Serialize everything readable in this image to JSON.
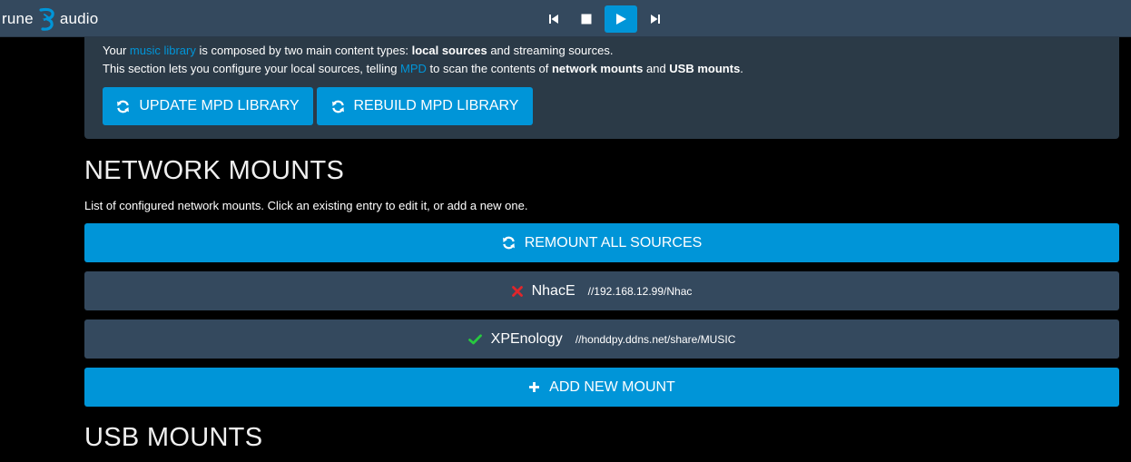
{
  "header": {
    "logo_left": "rune",
    "logo_right": "audio",
    "transport": {
      "prev_icon": "skip-previous-icon",
      "stop_icon": "stop-icon",
      "play_icon": "play-icon",
      "next_icon": "skip-next-icon"
    }
  },
  "library": {
    "line1_a": "Your ",
    "line1_link": "music library",
    "line1_b": " is composed by two main content types: ",
    "line1_bold": "local sources",
    "line1_c": " and streaming sources.",
    "line2_a": "This section lets you configure your local sources, telling ",
    "line2_link": "MPD",
    "line2_b": " to scan the contents of ",
    "line2_bold1": "network mounts",
    "line2_c": " and ",
    "line2_bold2": "USB mounts",
    "line2_d": ".",
    "update_label": "UPDATE MPD LIBRARY",
    "rebuild_label": "REBUILD MPD LIBRARY"
  },
  "network": {
    "title": "NETWORK MOUNTS",
    "description": "List of configured network mounts. Click an existing entry to edit it, or add a new one.",
    "remount_label": "REMOUNT ALL SOURCES",
    "mounts": [
      {
        "name": "NhacE",
        "address": "//192.168.12.99/Nhac",
        "status": "error",
        "status_color": "#e0262b"
      },
      {
        "name": "XPEnology",
        "address": "//honddpy.ddns.net/share/MUSIC",
        "status": "ok",
        "status_color": "#27c93f"
      }
    ],
    "add_label": "ADD NEW MOUNT"
  },
  "usb": {
    "title": "USB MOUNTS"
  },
  "colors": {
    "accent": "#0095d8",
    "topbar": "#34495e",
    "panel": "#2b3a47",
    "row": "#34495e"
  }
}
